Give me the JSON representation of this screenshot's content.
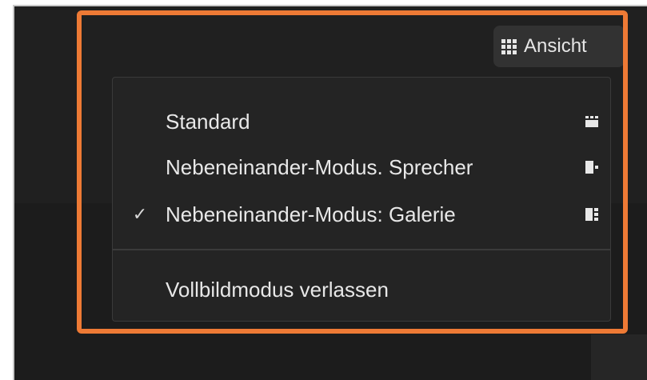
{
  "toolbar": {
    "view_button_label": "Ansicht",
    "view_button_icon": "grid-icon"
  },
  "view_menu": {
    "items": [
      {
        "label": "Standard",
        "checked": false,
        "icon": "standard-layout-icon"
      },
      {
        "label": "Nebeneinander-Modus. Sprecher",
        "checked": false,
        "icon": "side-by-side-speaker-icon"
      },
      {
        "label": "Nebeneinander-Modus: Galerie",
        "checked": true,
        "check_mark": "✓",
        "icon": "side-by-side-gallery-icon"
      }
    ],
    "exit_fullscreen_label": "Vollbildmodus verlassen"
  },
  "colors": {
    "highlight": "#ee7a35",
    "menu_background": "#242424",
    "screen_background": "#202020"
  }
}
